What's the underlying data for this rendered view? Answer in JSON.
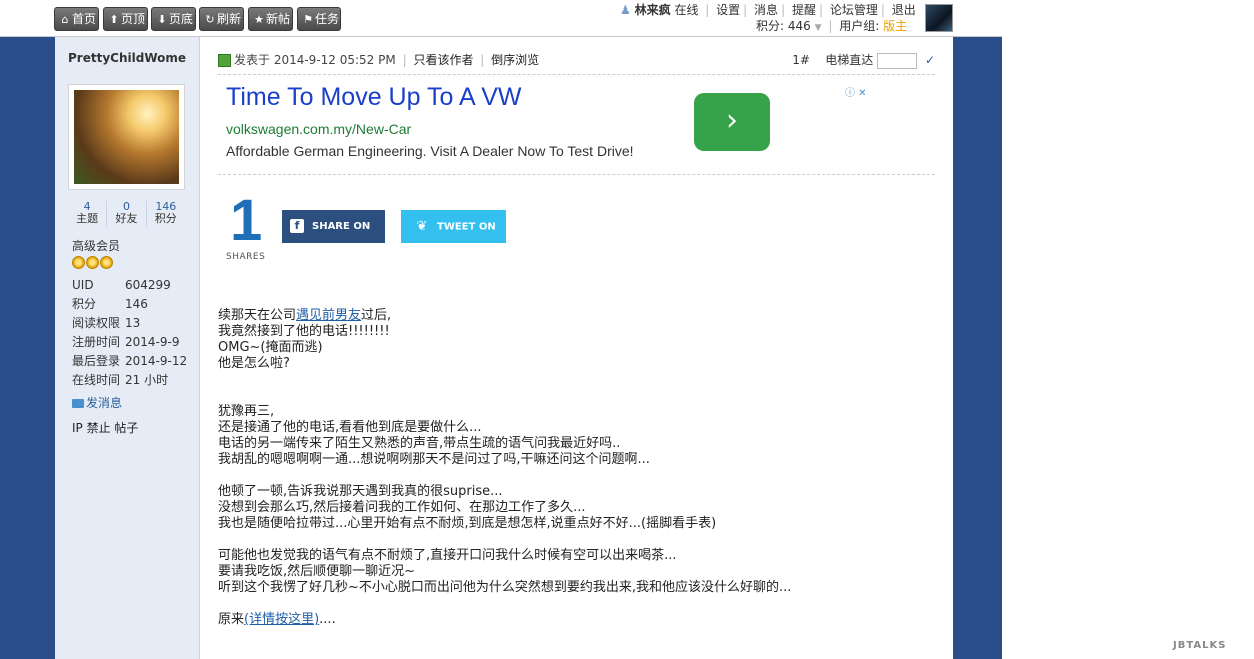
{
  "topnav": {
    "buttons": [
      {
        "icon": "home-icon",
        "glyph": "⌂",
        "label": "首页"
      },
      {
        "icon": "arrow-up-icon",
        "glyph": "⬆",
        "label": "页顶"
      },
      {
        "icon": "arrow-down-icon",
        "glyph": "⬇",
        "label": "页底"
      },
      {
        "icon": "refresh-icon",
        "glyph": "↻",
        "label": "刷新"
      },
      {
        "icon": "star-icon",
        "glyph": "★",
        "label": "新帖"
      },
      {
        "icon": "task-icon",
        "glyph": "⚑",
        "label": "任务"
      }
    ]
  },
  "user": {
    "name": "林来疯",
    "status": "在线",
    "links": [
      "设置",
      "消息",
      "提醒",
      "论坛管理",
      "退出"
    ],
    "points_label": "积分: 446",
    "group_label": "用户组:",
    "group_value": "版主"
  },
  "sidebar": {
    "username": "PrettyChildWome",
    "stats": [
      {
        "value": "4",
        "label": "主题"
      },
      {
        "value": "0",
        "label": "好友"
      },
      {
        "value": "146",
        "label": "积分"
      }
    ],
    "rank": "高级会员",
    "star_count": 3,
    "info": [
      {
        "key": "UID",
        "value": "604299"
      },
      {
        "key": "积分",
        "value": "146"
      },
      {
        "key": "阅读权限",
        "value": "13"
      },
      {
        "key": "注册时间",
        "value": "2014-9-9"
      },
      {
        "key": "最后登录",
        "value": "2014-9-12"
      },
      {
        "key": "在线时间",
        "value": "21 小时"
      }
    ],
    "send_message": "发消息",
    "ip_ban": "IP 禁止",
    "posts": "帖子"
  },
  "post": {
    "posted_at": "发表于 2014-9-12 05:52 PM",
    "author_only": "只看该作者",
    "reverse": "倒序浏览",
    "floor": "1#",
    "elevator_label": "电梯直达"
  },
  "ad": {
    "title": "Time To Move Up To A VW",
    "url": "volkswagen.com.my/New-Car",
    "description": "Affordable German Engineering. Visit A Dealer Now To Test Drive!",
    "cta": "›"
  },
  "share": {
    "count": "1",
    "count_label": "SHARES",
    "facebook_label": "SHARE ON",
    "twitter_label": "TWEET ON"
  },
  "body": {
    "p1_pre": "续那天在公司",
    "p1_link": "遇见前男友",
    "p1_post": "过后,",
    "p2": "我竟然接到了他的电话!!!!!!!!",
    "p3": "OMG~(掩面而逃)",
    "p4": "他是怎么啦?",
    "p5": "犹豫再三,",
    "p6": "还是接通了他的电话,看看他到底是要做什么...",
    "p7": "电话的另一端传来了陌生又熟悉的声音,带点生疏的语气问我最近好吗..",
    "p8": "我胡乱的嗯嗯啊啊一通...想说啊咧那天不是问过了吗,干嘛还问这个问题啊...",
    "p9": "他顿了一顿,告诉我说那天遇到我真的很suprise...",
    "p10": "没想到会那么巧,然后接着问我的工作如何、在那边工作了多久...",
    "p11": "我也是随便哈拉带过...心里开始有点不耐烦,到底是想怎样,说重点好不好...(摇脚看手表)",
    "p12": "可能他也发觉我的语气有点不耐烦了,直接开口问我什么时候有空可以出来喝茶...",
    "p13": "要请我吃饭,然后顺便聊一聊近况~",
    "p14": "听到这个我愣了好几秒~不小心脱口而出问他为什么突然想到要约我出来,我和他应该没什么好聊的...",
    "p15_pre": "原来",
    "p15_link": "(详情按这里)",
    "p15_post": "...."
  },
  "watermark": "JBTALKS"
}
